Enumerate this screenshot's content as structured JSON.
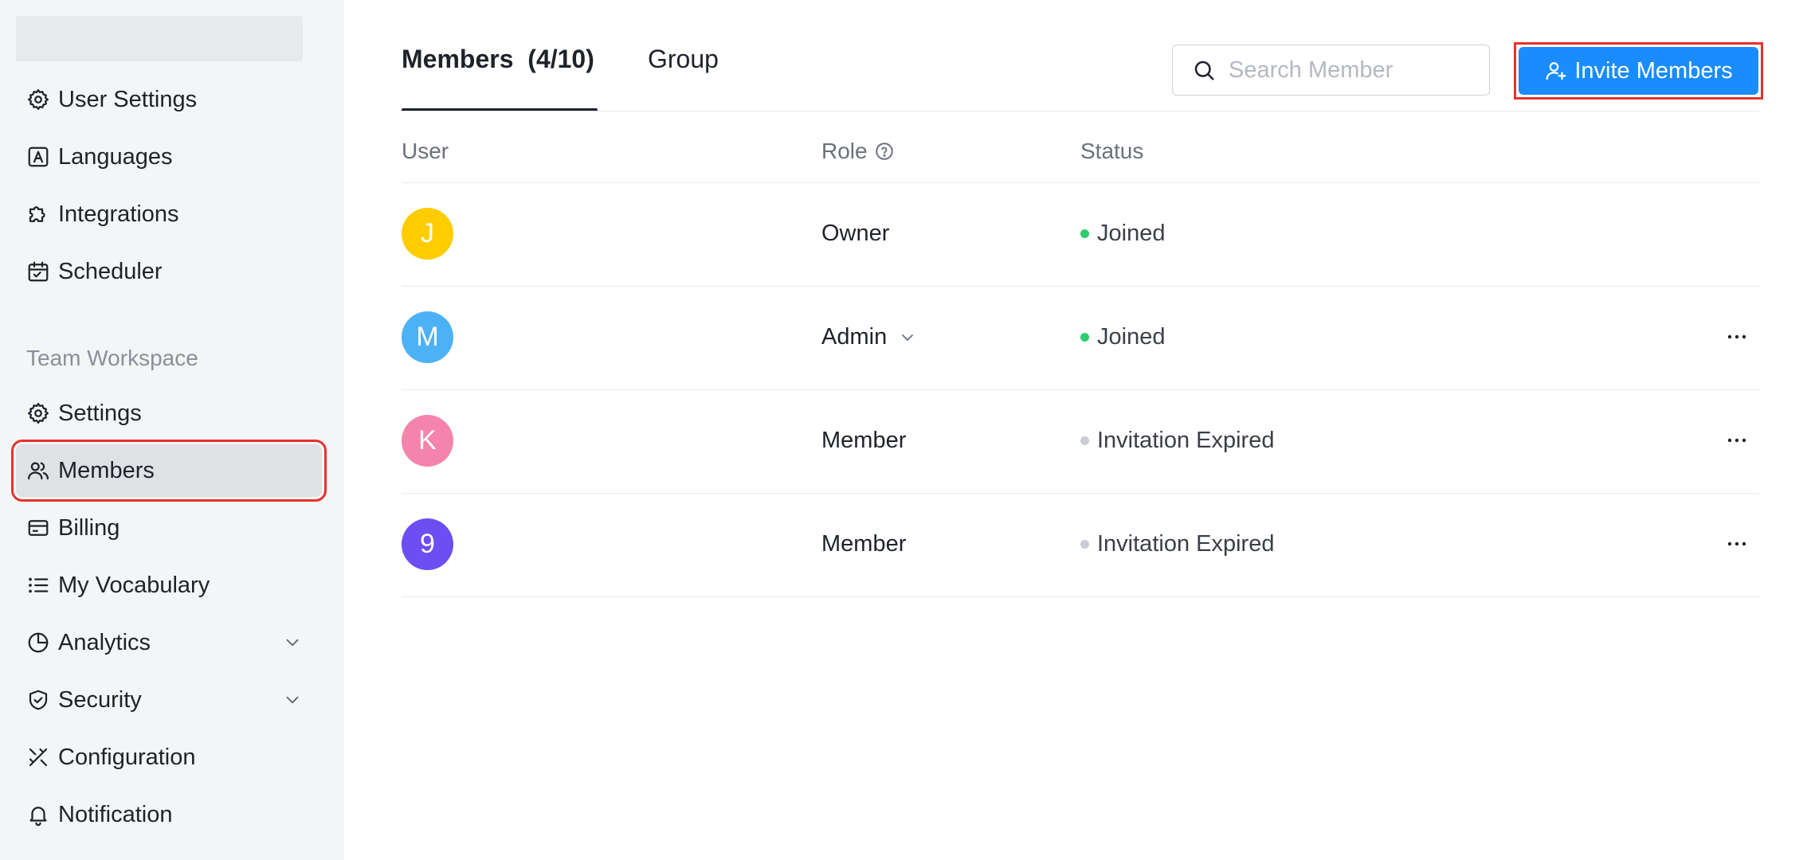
{
  "sidebar": {
    "section_label": "Team Workspace",
    "items": [
      {
        "label": "User Settings",
        "icon": "gear-icon"
      },
      {
        "label": "Languages",
        "icon": "language-icon"
      },
      {
        "label": "Integrations",
        "icon": "puzzle-icon"
      },
      {
        "label": "Scheduler",
        "icon": "calendar-icon"
      },
      {
        "label": "Settings",
        "icon": "gear-icon"
      },
      {
        "label": "Members",
        "icon": "users-icon",
        "active": true
      },
      {
        "label": "Billing",
        "icon": "credit-card-icon"
      },
      {
        "label": "My Vocabulary",
        "icon": "list-icon"
      },
      {
        "label": "Analytics",
        "icon": "pie-chart-icon",
        "expandable": true
      },
      {
        "label": "Security",
        "icon": "shield-icon",
        "expandable": true
      },
      {
        "label": "Configuration",
        "icon": "tools-icon"
      },
      {
        "label": "Notification",
        "icon": "bell-icon"
      }
    ]
  },
  "tabs": {
    "members": "Members  (4/10)",
    "group": "Group"
  },
  "search": {
    "placeholder": "Search Member",
    "value": ""
  },
  "invite_button": {
    "label": "Invite Members"
  },
  "table": {
    "headers": {
      "user": "User",
      "role": "Role",
      "status": "Status"
    },
    "rows": [
      {
        "initial": "J",
        "avatar_color": "#ffcc00",
        "role": "Owner",
        "role_dropdown": false,
        "status": "Joined",
        "status_color": "#2ecc71",
        "has_more": false
      },
      {
        "initial": "M",
        "avatar_color": "#4db1f5",
        "role": "Admin",
        "role_dropdown": true,
        "status": "Joined",
        "status_color": "#2ecc71",
        "has_more": true
      },
      {
        "initial": "K",
        "avatar_color": "#f584ad",
        "role": "Member",
        "role_dropdown": false,
        "status": "Invitation Expired",
        "status_color": "#c9ccd2",
        "has_more": true
      },
      {
        "initial": "9",
        "avatar_color": "#6c4ef2",
        "role": "Member",
        "role_dropdown": false,
        "status": "Invitation Expired",
        "status_color": "#c9ccd2",
        "has_more": true
      }
    ]
  },
  "colors": {
    "accent": "#1a8cff",
    "sidebar_bg": "#f4f5f7",
    "active_item_bg": "#dfe1e5",
    "highlight_border": "#e5322d"
  }
}
